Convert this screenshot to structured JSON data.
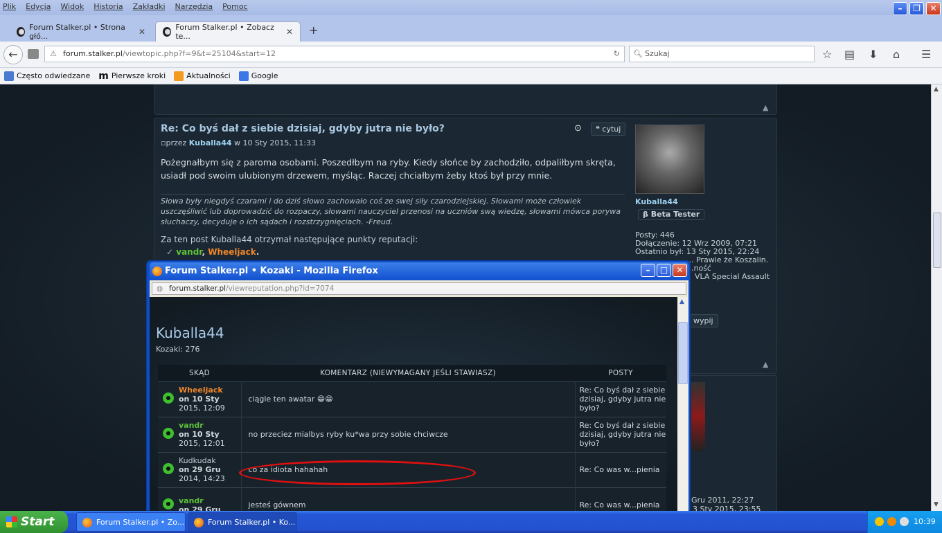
{
  "browser": {
    "menu": [
      "Plik",
      "Edycja",
      "Widok",
      "Historia",
      "Zakładki",
      "Narzędzia",
      "Pomoc"
    ],
    "tabs": [
      {
        "label": "Forum Stalker.pl • Strona głó..."
      },
      {
        "label": "Forum Stalker.pl • Zobacz te..."
      }
    ],
    "url_host": "forum.stalker.pl",
    "url_path": "/viewtopic.php?f=9&t=25104&start=12",
    "search_placeholder": "Szukaj",
    "bookmarks": [
      "Często odwiedzane",
      "Pierwsze kroki",
      "Aktualności",
      "Google"
    ]
  },
  "post": {
    "title": "Re: Co byś dał z siebie dzisiaj, gdyby jutra nie było?",
    "quote_label": "cytuj",
    "meta_prefix": "przez",
    "author": "Kuballa44",
    "meta_date": "w 10 Sty 2015, 11:33",
    "body": "Pożegnałbym się z paroma osobami. Poszedłbym na ryby. Kiedy słońce by zachodziło, odpaliłbym skręta, usiadł pod swoim ulubionym drzewem, myśląc. Raczej chciałbym żeby ktoś był przy mnie.",
    "signature": "Słowa były niegdyś czarami i do dziś słowo zachowało coś ze swej siły czarodziejskiej. Słowami może człowiek uszczęśliwić lub doprowadzić do rozpaczy, słowami nauczyciel przenosi na uczniów swą wiedzę, słowami mówca porywa słuchaczy, decyduje o ich sądach i rozstrzygnięciach. -Freud.",
    "rep_text": "Za ten post Kuballa44 otrzymał następujące punkty reputacji:",
    "rep_user1": "vandr",
    "rep_user2": "Wheeljack",
    "side_name": "Kuballa44",
    "side_rank": "Beta Tester",
    "side_lines": [
      "Posty: 446",
      "Dołączenie: 12 Wrz 2009, 07:21",
      "Ostatnio był: 13 Sty 2015, 22:24",
      "... Prawie że Koszalin.",
      "...ność",
      "VLA Special Assault"
    ],
    "side_btn": "wypij",
    "side_bottom1": "Gru 2011, 22:27",
    "side_bottom2": "3 Sty 2015, 23:55"
  },
  "popup": {
    "title": "Forum Stalker.pl • Kozaki - Mozilla Firefox",
    "url_host": "forum.stalker.pl",
    "url_path": "/viewreputation.php?id=7074",
    "username": "Kuballa44",
    "kozaki": "Kozaki: 276",
    "headers": [
      "SKĄD",
      "KOMENTARZ (NIEWYMAGANY JEŚLI STAWIASZ)",
      "POSTY"
    ],
    "rows": [
      {
        "user": "Wheeljack",
        "color": "#f0862a",
        "date1": "on 10 Sty",
        "date2": "2015, 12:09",
        "comment": "ciągle ten awatar 😁😁",
        "post": "Re: Co byś dał z siebie dzisiaj, gdyby jutra nie było?"
      },
      {
        "user": "vandr",
        "color": "#5ec23a",
        "date1": "on 10 Sty",
        "date2": "2015, 12:01",
        "comment": "no przeciez mialbys ryby ku*wa przy sobie chciwcze",
        "post": "Re: Co byś dał z siebie dzisiaj, gdyby jutra nie było?"
      },
      {
        "user": "Kudkudak",
        "color": "#c3ccd3",
        "date1": "on 29 Gru",
        "date2": "2014, 14:23",
        "comment": "co za idiota hahahah",
        "post": "Re: Co was w...pienia"
      },
      {
        "user": "vandr",
        "color": "#5ec23a",
        "date1": "on 29 Gru",
        "date2": "",
        "comment": "jesteś gównem",
        "post": "Re: Co was w...pienia"
      }
    ]
  },
  "taskbar": {
    "start": "Start",
    "tasks": [
      "Forum Stalker.pl • Zo...",
      "Forum Stalker.pl • Ko..."
    ],
    "clock": "10:39"
  }
}
